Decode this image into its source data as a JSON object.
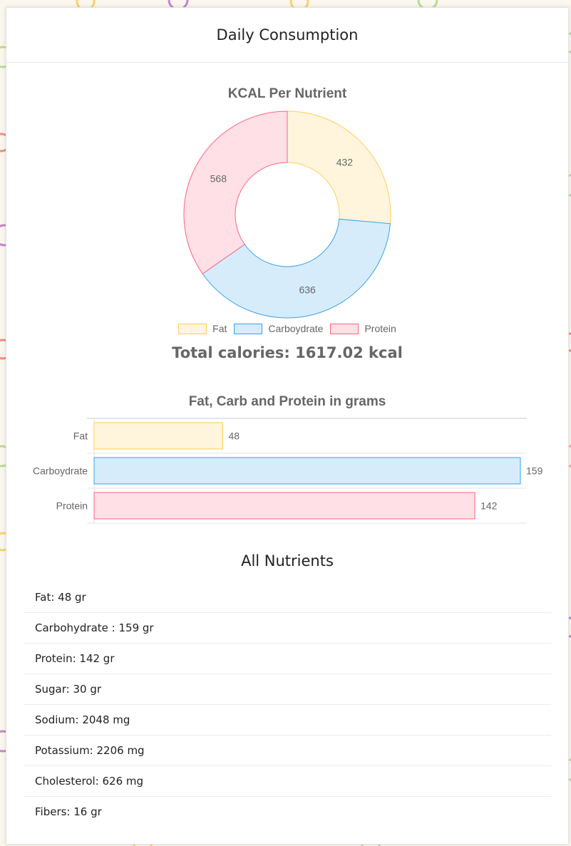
{
  "card": {
    "title": "Daily Consumption"
  },
  "donut": {
    "title": "KCAL Per Nutrient",
    "legend": [
      "Fat",
      "Carboydrate",
      "Protein"
    ]
  },
  "total": {
    "text": "Total calories: 1617.02 kcal"
  },
  "bars": {
    "title": "Fat, Carb and Protein in grams"
  },
  "nutrients": {
    "title": "All Nutrients",
    "items": [
      "Fat: 48 gr",
      "Carbohydrate : 159 gr",
      "Protein: 142 gr",
      "Sugar: 30 gr",
      "Sodium: 2048 mg",
      "Potassium: 2206 mg",
      "Cholesterol: 626 mg",
      "Fibers: 16 gr"
    ]
  },
  "colors": {
    "fat_fill": "#fff5dd",
    "fat_stroke": "#ffce56",
    "carb_fill": "#d7ecfb",
    "carb_stroke": "#36a2eb",
    "protein_fill": "#ffe0e6",
    "protein_stroke": "#ff6384",
    "text_gray": "#666666"
  },
  "chart_data": [
    {
      "type": "pie",
      "title": "KCAL Per Nutrient",
      "categories": [
        "Fat",
        "Carboydrate",
        "Protein"
      ],
      "values": [
        432,
        636,
        568
      ],
      "legend_position": "bottom",
      "colors": [
        "#fff5dd",
        "#d7ecfb",
        "#ffe0e6"
      ],
      "borders": [
        "#ffce56",
        "#36a2eb",
        "#ff6384"
      ]
    },
    {
      "type": "bar",
      "orientation": "horizontal",
      "title": "Fat, Carb and Protein in grams",
      "categories": [
        "Fat",
        "Carboydrate",
        "Protein"
      ],
      "values": [
        48,
        159,
        142
      ],
      "xlim": [
        0,
        159
      ],
      "grid": true,
      "colors": [
        "#fff5dd",
        "#d7ecfb",
        "#ffe0e6"
      ],
      "borders": [
        "#ffce56",
        "#36a2eb",
        "#ff6384"
      ]
    }
  ]
}
